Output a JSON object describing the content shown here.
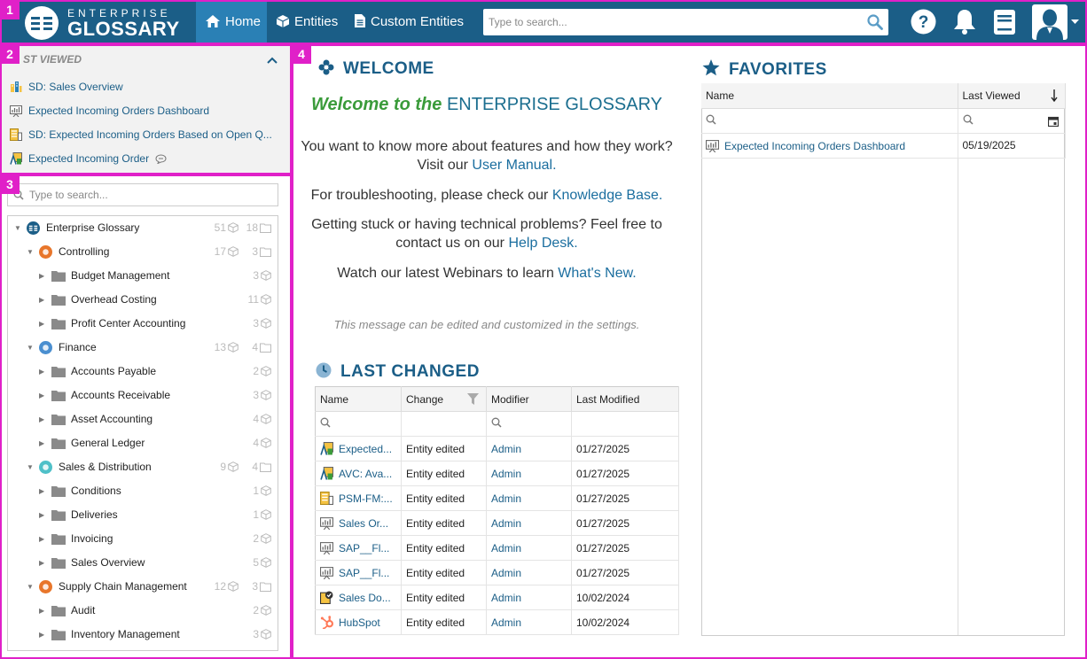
{
  "header": {
    "logo_line1": "ENTERPRISE",
    "logo_line2": "GLOSSARY",
    "tabs": [
      {
        "label": "Home",
        "icon": "home-icon"
      },
      {
        "label": "Entities",
        "icon": "cube-icon"
      },
      {
        "label": "Custom Entities",
        "icon": "document-icon"
      }
    ],
    "search_placeholder": "Type to search..."
  },
  "region_numbers": [
    "1",
    "2",
    "3",
    "4"
  ],
  "last_viewed": {
    "title": "ST VIEWED",
    "items": [
      {
        "label": "SD: Sales Overview",
        "icon": "report-icon"
      },
      {
        "label": "Expected Incoming Orders Dashboard",
        "icon": "dashboard-icon"
      },
      {
        "label": "SD: Expected Incoming Orders Based on Open Q...",
        "icon": "table-report-icon"
      },
      {
        "label": "Expected Incoming Order",
        "icon": "entity-icon"
      }
    ]
  },
  "tree": {
    "search_placeholder": "Type to search...",
    "nodes": [
      {
        "label": "Enterprise Glossary",
        "level": 0,
        "expanded": true,
        "kind": "root",
        "entities": "51",
        "folders": "18"
      },
      {
        "label": "Controlling",
        "level": 1,
        "expanded": true,
        "kind": "area",
        "entities": "17",
        "folders": "3"
      },
      {
        "label": "Budget Management",
        "level": 2,
        "expanded": false,
        "kind": "folder",
        "entities": "3"
      },
      {
        "label": "Overhead Costing",
        "level": 2,
        "expanded": false,
        "kind": "folder",
        "entities": "11"
      },
      {
        "label": "Profit Center Accounting",
        "level": 2,
        "expanded": false,
        "kind": "folder",
        "entities": "3"
      },
      {
        "label": "Finance",
        "level": 1,
        "expanded": true,
        "kind": "area",
        "entities": "13",
        "folders": "4"
      },
      {
        "label": "Accounts Payable",
        "level": 2,
        "expanded": false,
        "kind": "folder",
        "entities": "2"
      },
      {
        "label": "Accounts Receivable",
        "level": 2,
        "expanded": false,
        "kind": "folder",
        "entities": "3"
      },
      {
        "label": "Asset Accounting",
        "level": 2,
        "expanded": false,
        "kind": "folder",
        "entities": "4"
      },
      {
        "label": "General Ledger",
        "level": 2,
        "expanded": false,
        "kind": "folder",
        "entities": "4"
      },
      {
        "label": "Sales & Distribution",
        "level": 1,
        "expanded": true,
        "kind": "area",
        "entities": "9",
        "folders": "4"
      },
      {
        "label": "Conditions",
        "level": 2,
        "expanded": false,
        "kind": "folder",
        "entities": "1"
      },
      {
        "label": "Deliveries",
        "level": 2,
        "expanded": false,
        "kind": "folder",
        "entities": "1"
      },
      {
        "label": "Invoicing",
        "level": 2,
        "expanded": false,
        "kind": "folder",
        "entities": "2"
      },
      {
        "label": "Sales Overview",
        "level": 2,
        "expanded": false,
        "kind": "folder",
        "entities": "5"
      },
      {
        "label": "Supply Chain Management",
        "level": 1,
        "expanded": true,
        "kind": "area",
        "entities": "12",
        "folders": "3"
      },
      {
        "label": "Audit",
        "level": 2,
        "expanded": false,
        "kind": "folder",
        "entities": "2"
      },
      {
        "label": "Inventory Management",
        "level": 2,
        "expanded": false,
        "kind": "folder",
        "entities": "3"
      }
    ]
  },
  "welcome": {
    "title": "WELCOME",
    "head_green": "Welcome to the",
    "head_blue": "ENTERPRISE GLOSSARY",
    "p1_text": "You want to know more about features and how they work? Visit our",
    "p1_link": "User Manual.",
    "p2_text": "For troubleshooting, please check our",
    "p2_link": "Knowledge Base.",
    "p3_text": "Getting stuck or having technical problems? Feel free to contact us on our",
    "p3_link": "Help Desk.",
    "p4_text": "Watch our latest Webinars to learn",
    "p4_link": "What's New.",
    "note": "This message can be edited and customized in the settings."
  },
  "last_changed": {
    "title": "LAST CHANGED",
    "columns": [
      "Name",
      "Change",
      "Modifier",
      "Last Modified"
    ],
    "rows": [
      {
        "name": "Expected...",
        "icon": "entity-icon",
        "change": "Entity edited",
        "modifier": "Admin",
        "date": "01/27/2025"
      },
      {
        "name": "AVC: Ava...",
        "icon": "entity-icon",
        "change": "Entity edited",
        "modifier": "Admin",
        "date": "01/27/2025"
      },
      {
        "name": "PSM-FM:...",
        "icon": "table-report-icon",
        "change": "Entity edited",
        "modifier": "Admin",
        "date": "01/27/2025"
      },
      {
        "name": "Sales Or...",
        "icon": "dashboard-icon",
        "change": "Entity edited",
        "modifier": "Admin",
        "date": "01/27/2025"
      },
      {
        "name": "SAP__Fl...",
        "icon": "dashboard-icon",
        "change": "Entity edited",
        "modifier": "Admin",
        "date": "01/27/2025"
      },
      {
        "name": "SAP__Fl...",
        "icon": "dashboard-icon",
        "change": "Entity edited",
        "modifier": "Admin",
        "date": "01/27/2025"
      },
      {
        "name": "Sales Do...",
        "icon": "sales-doc-icon",
        "change": "Entity edited",
        "modifier": "Admin",
        "date": "10/02/2024"
      },
      {
        "name": "HubSpot",
        "icon": "hubspot-icon",
        "change": "Entity edited",
        "modifier": "Admin",
        "date": "10/02/2024"
      }
    ]
  },
  "favorites": {
    "title": "FAVORITES",
    "columns": [
      "Name",
      "Last Viewed"
    ],
    "rows": [
      {
        "name": "Expected Incoming Orders Dashboard",
        "icon": "dashboard-icon",
        "last_viewed": "05/19/2025"
      }
    ]
  },
  "colors": {
    "brand": "#1b5e87",
    "active_tab": "#2a80b5",
    "link": "#1b5e87",
    "welcome_green": "#3a9b3a",
    "region_marker": "#e020c8"
  }
}
